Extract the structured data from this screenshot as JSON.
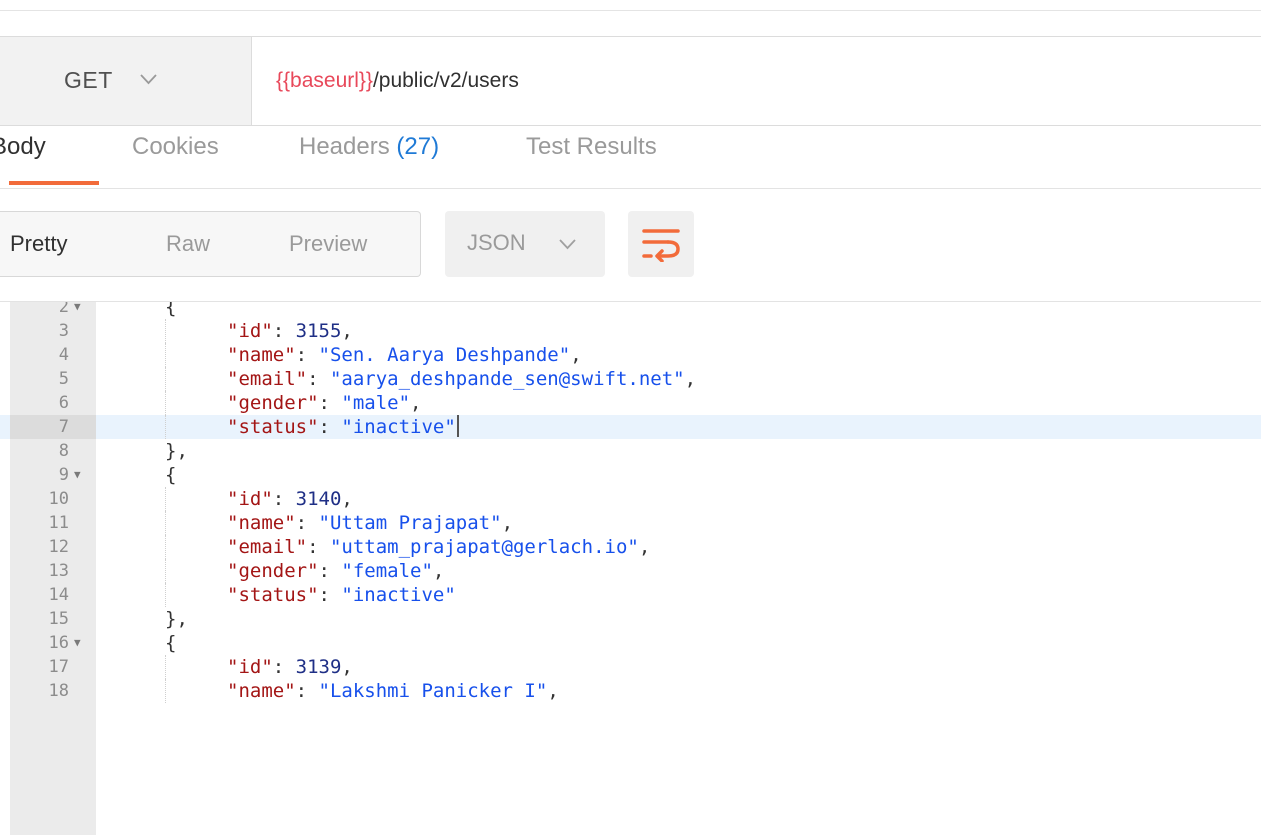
{
  "request": {
    "method": "GET",
    "url_variable": "{{baseurl}}",
    "url_path": "/public/v2/users"
  },
  "response_tabs": [
    {
      "label": "Body",
      "active": true
    },
    {
      "label": "Cookies",
      "active": false
    },
    {
      "label": "Headers",
      "count": "(27)",
      "active": false
    },
    {
      "label": "Test Results",
      "active": false
    }
  ],
  "view_modes": {
    "pretty": "Pretty",
    "raw": "Raw",
    "preview": "Preview",
    "selected": "Pretty"
  },
  "format": "JSON",
  "icons": {
    "method_dropdown": "chevron-down-icon",
    "format_dropdown": "chevron-down-icon",
    "wrap": "wrap-lines-icon"
  },
  "colors": {
    "accent": "#f26b3a",
    "url_variable": "#e8485a",
    "headers_count": "#1f7ad6",
    "json_key": "#a31515",
    "json_string": "#1750eb",
    "json_number": "#1f2f86",
    "highlight_line": "#e9f3fd"
  },
  "code": {
    "highlighted_line": "7",
    "lines": [
      {
        "n": "2",
        "fold": true,
        "punct": "{"
      },
      {
        "n": "3",
        "key": "\"id\"",
        "sep": ": ",
        "num": "3155",
        "tail": ","
      },
      {
        "n": "4",
        "key": "\"name\"",
        "sep": ": ",
        "str": "\"Sen. Aarya Deshpande\"",
        "tail": ","
      },
      {
        "n": "5",
        "key": "\"email\"",
        "sep": ": ",
        "str": "\"aarya_deshpande_sen@swift.net\"",
        "tail": ","
      },
      {
        "n": "6",
        "key": "\"gender\"",
        "sep": ": ",
        "str": "\"male\"",
        "tail": ","
      },
      {
        "n": "7",
        "key": "\"status\"",
        "sep": ": ",
        "str": "\"inactive\"",
        "tail": ""
      },
      {
        "n": "8",
        "punct": "},"
      },
      {
        "n": "9",
        "fold": true,
        "punct": "{"
      },
      {
        "n": "10",
        "key": "\"id\"",
        "sep": ": ",
        "num": "3140",
        "tail": ","
      },
      {
        "n": "11",
        "key": "\"name\"",
        "sep": ": ",
        "str": "\"Uttam Prajapat\"",
        "tail": ","
      },
      {
        "n": "12",
        "key": "\"email\"",
        "sep": ": ",
        "str": "\"uttam_prajapat@gerlach.io\"",
        "tail": ","
      },
      {
        "n": "13",
        "key": "\"gender\"",
        "sep": ": ",
        "str": "\"female\"",
        "tail": ","
      },
      {
        "n": "14",
        "key": "\"status\"",
        "sep": ": ",
        "str": "\"inactive\"",
        "tail": ""
      },
      {
        "n": "15",
        "punct": "},"
      },
      {
        "n": "16",
        "fold": true,
        "punct": "{"
      },
      {
        "n": "17",
        "key": "\"id\"",
        "sep": ": ",
        "num": "3139",
        "tail": ","
      },
      {
        "n": "18",
        "key": "\"name\"",
        "sep": ": ",
        "str": "\"Lakshmi Panicker I\"",
        "tail": ","
      }
    ]
  }
}
